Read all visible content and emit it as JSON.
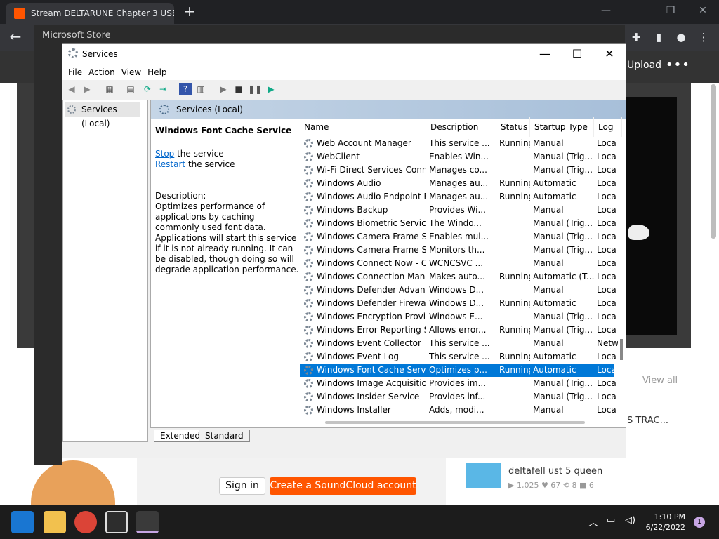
{
  "browser": {
    "tab_title": "Stream DELTARUNE Chapter 3 USE",
    "new_tab": "+"
  },
  "store": {
    "title": "Microsoft Store"
  },
  "soundcloud": {
    "upload": "Upload",
    "more": "•••",
    "view_all": "View all",
    "trac_text": "S TRAC...",
    "sign_in": "Sign in",
    "create_account": "Create a SoundCloud account",
    "track": {
      "title": "deltafell ust 5 queen",
      "stats": "▶ 1,025   ♥ 67   ⟲ 8   ■ 6"
    }
  },
  "services": {
    "title": "Services",
    "menu": [
      "File",
      "Action",
      "View",
      "Help"
    ],
    "tree_item": "Services (Local)",
    "banner": "Services (Local)",
    "selected": {
      "name": "Windows Font Cache Service",
      "stop": "Stop",
      "stop_rest": " the service",
      "restart": "Restart",
      "restart_rest": " the service",
      "desc_label": "Description:",
      "desc": "Optimizes performance of applications by caching commonly used font data. Applications will start this service if it is not already running. It can be disabled, though doing so will degrade application performance."
    },
    "columns": [
      "Name",
      "Description",
      "Status",
      "Startup Type",
      "Log"
    ],
    "rows": [
      [
        "Web Account Manager",
        "This service ...",
        "Running",
        "Manual",
        "Loca"
      ],
      [
        "WebClient",
        "Enables Win...",
        "",
        "Manual (Trig...",
        "Loca"
      ],
      [
        "Wi-Fi Direct Services Conne...",
        "Manages co...",
        "",
        "Manual (Trig...",
        "Loca"
      ],
      [
        "Windows Audio",
        "Manages au...",
        "Running",
        "Automatic",
        "Loca"
      ],
      [
        "Windows Audio Endpoint B...",
        "Manages au...",
        "Running",
        "Automatic",
        "Loca"
      ],
      [
        "Windows Backup",
        "Provides Wi...",
        "",
        "Manual",
        "Loca"
      ],
      [
        "Windows Biometric Service",
        "The Windo...",
        "",
        "Manual (Trig...",
        "Loca"
      ],
      [
        "Windows Camera Frame Se...",
        "Enables mul...",
        "",
        "Manual (Trig...",
        "Loca"
      ],
      [
        "Windows Camera Frame Se...",
        "Monitors th...",
        "",
        "Manual (Trig...",
        "Loca"
      ],
      [
        "Windows Connect Now - C...",
        "WCNCSVC ...",
        "",
        "Manual",
        "Loca"
      ],
      [
        "Windows Connection Mana...",
        "Makes auto...",
        "Running",
        "Automatic (T...",
        "Loca"
      ],
      [
        "Windows Defender Advanc...",
        "Windows D...",
        "",
        "Manual",
        "Loca"
      ],
      [
        "Windows Defender Firewall",
        "Windows D...",
        "Running",
        "Automatic",
        "Loca"
      ],
      [
        "Windows Encryption Provid...",
        "Windows E...",
        "",
        "Manual (Trig...",
        "Loca"
      ],
      [
        "Windows Error Reporting Se...",
        "Allows error...",
        "Running",
        "Manual (Trig...",
        "Loca"
      ],
      [
        "Windows Event Collector",
        "This service ...",
        "",
        "Manual",
        "Netw"
      ],
      [
        "Windows Event Log",
        "This service ...",
        "Running",
        "Automatic",
        "Loca"
      ],
      [
        "Windows Font Cache Service",
        "Optimizes p...",
        "Running",
        "Automatic",
        "Loca"
      ],
      [
        "Windows Image Acquisitio...",
        "Provides im...",
        "",
        "Manual (Trig...",
        "Loca"
      ],
      [
        "Windows Insider Service",
        "Provides inf...",
        "",
        "Manual (Trig...",
        "Loca"
      ],
      [
        "Windows Installer",
        "Adds, modi...",
        "",
        "Manual",
        "Loca"
      ]
    ],
    "selected_index": 17,
    "view_tabs": [
      "Extended",
      "Standard"
    ]
  },
  "taskbar": {
    "time": "1:10 PM",
    "date": "6/22/2022",
    "notifications": "1"
  }
}
